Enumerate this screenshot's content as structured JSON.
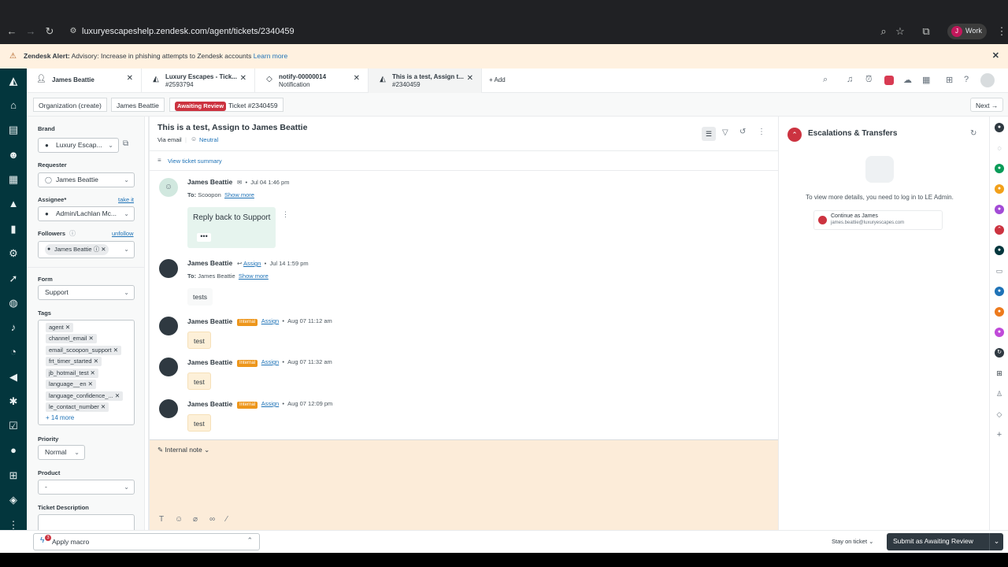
{
  "browser": {
    "url": "luxuryescapeshelp.zendesk.com/agent/tickets/2340459",
    "profile_initial": "J",
    "profile_label": "Work"
  },
  "alert": {
    "title": "Zendesk Alert:",
    "message": "Advisory: Increase in phishing attempts to Zendesk accounts",
    "link": "Learn more"
  },
  "tabs": [
    {
      "title": "James Beattie",
      "subtitle": ""
    },
    {
      "title": "Luxury Escapes - Tick...",
      "subtitle": "#2593794"
    },
    {
      "title": "notify-00000014",
      "subtitle": "Notification"
    },
    {
      "title": "This is a test, Assign t...",
      "subtitle": "#2340459"
    }
  ],
  "add_tab_label": "Add",
  "breadcrumb": {
    "org": "Organization (create)",
    "user": "James Beattie",
    "status": "Awaiting Review",
    "ticket": "Ticket #2340459",
    "next": "Next"
  },
  "props": {
    "brand_label": "Brand",
    "brand_value": "Luxury Escap...",
    "requester_label": "Requester",
    "requester_value": "James Beattie",
    "assignee_label": "Assignee*",
    "take_it": "take it",
    "assignee_value": "Admin/Lachlan Mc...",
    "followers_label": "Followers",
    "unfollow": "unfollow",
    "follower_value": "James Beattie",
    "form_label": "Form",
    "form_value": "Support",
    "tags_label": "Tags",
    "tags": [
      "agent",
      "channel_email",
      "email_scoopon_support",
      "frt_timer_started",
      "jb_hotmail_test",
      "language__en",
      "language_confidence_...",
      "le_contact_number"
    ],
    "more_tags": "+ 14 more",
    "priority_label": "Priority",
    "priority_value": "Normal",
    "product_label": "Product",
    "product_value": "-",
    "ticket_desc_label": "Ticket Description"
  },
  "ticket": {
    "title": "This is a test, Assign to James Beattie",
    "via": "Via email",
    "sentiment": "Neutral",
    "summary_link": "View ticket summary"
  },
  "messages": [
    {
      "author": "James Beattie",
      "time": "Jul 04 1:46 pm",
      "to_label": "To:",
      "to": "Scoopon",
      "show_more": "Show more",
      "body": "Reply back to Support"
    },
    {
      "author": "James Beattie",
      "assign": "Assign",
      "time": "Jul 14 1:59 pm",
      "to_label": "To:",
      "to": "James Beattie",
      "show_more": "Show more",
      "body": "tests"
    },
    {
      "author": "James Beattie",
      "internal": "Internal",
      "assign": "Assign",
      "time": "Aug 07 11:12 am",
      "body": "test"
    },
    {
      "author": "James Beattie",
      "internal": "Internal",
      "assign": "Assign",
      "time": "Aug 07 11:32 am",
      "body": "test"
    },
    {
      "author": "James Beattie",
      "internal": "Internal",
      "assign": "Assign",
      "time": "Aug 07 12:09 pm",
      "body": "test"
    }
  ],
  "composer": {
    "mode": "Internal note"
  },
  "right_panel": {
    "title": "Escalations & Transfers",
    "info": "To view more details, you need to log in to LE Admin.",
    "continue_label": "Continue as James",
    "continue_email": "james.beattie@luxuryescapes.com"
  },
  "bottom": {
    "macro": "Apply macro",
    "macro_badge": "3",
    "stay": "Stay on ticket",
    "submit": "Submit as Awaiting Review"
  }
}
